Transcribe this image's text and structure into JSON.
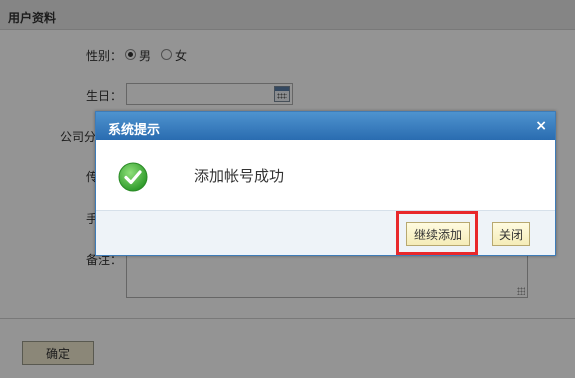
{
  "page": {
    "title": "用户资料",
    "gender_label": "性别：",
    "gender_options": [
      {
        "label": "男",
        "checked": true
      },
      {
        "label": "女",
        "checked": false
      }
    ],
    "birthday_label": "生日：",
    "birthday_value": "",
    "company_label": "公司分",
    "fax_label": "传",
    "mobile_label": "手",
    "remark_label": "备注：",
    "confirm_button": "确定"
  },
  "dialog": {
    "title": "系统提示",
    "close_symbol": "×",
    "message": "添加帐号成功",
    "continue_button": "继续添加",
    "close_button": "关闭",
    "highlight_color": "#e8282b",
    "title_color": "#2a6cb0"
  }
}
